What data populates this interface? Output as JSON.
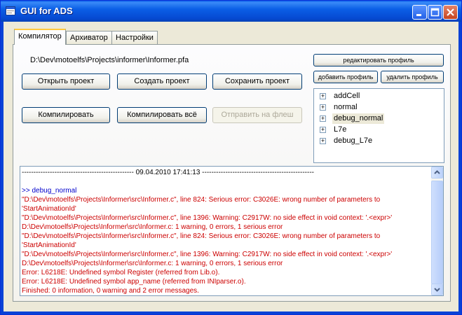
{
  "window": {
    "title": "GUI for ADS"
  },
  "tabs": [
    {
      "label": "Компилятор"
    },
    {
      "label": "Архиватор"
    },
    {
      "label": "Настройки"
    }
  ],
  "compiler": {
    "project_path": "D:\\Dev\\motoelfs\\Projects\\informer\\Informer.pfa",
    "buttons": {
      "open": "Открыть проект",
      "create": "Создать проект",
      "save": "Сохранить проект",
      "compile": "Компилировать",
      "compile_all": "Компилировать всё",
      "send_flash": "Отправить на флеш"
    },
    "profile_buttons": {
      "edit": "редактировать профиль",
      "add": "добавить профиль",
      "delete": "удалить профиль"
    },
    "profiles": [
      {
        "label": "addCell",
        "selected": false
      },
      {
        "label": "normal",
        "selected": false
      },
      {
        "label": "debug_normal",
        "selected": true
      },
      {
        "label": "L7e",
        "selected": false
      },
      {
        "label": "debug_L7e",
        "selected": false
      }
    ],
    "expander_glyph": "+"
  },
  "log": {
    "lines": [
      {
        "kind": "header",
        "text": "------------------------------------------------ 09.04.2010 17:41:13 ------------------------------------------------"
      },
      {
        "kind": "blank",
        "text": ""
      },
      {
        "kind": "blue",
        "text": ">> debug_normal"
      },
      {
        "kind": "red",
        "text": "\"D:\\Dev\\motoelfs\\Projects\\Informer\\src\\Informer.c\", line 824: Serious error: C3026E: wrong number of parameters to"
      },
      {
        "kind": "red",
        "text": "'StartAnimationId'"
      },
      {
        "kind": "red",
        "text": "\"D:\\Dev\\motoelfs\\Projects\\Informer\\src\\Informer.c\", line 1396: Warning: C2917W: no side effect in void context: '.<expr>'"
      },
      {
        "kind": "red",
        "text": "D:\\Dev\\motoelfs\\Projects\\Informer\\src\\Informer.c: 1 warning, 0 errors, 1 serious error"
      },
      {
        "kind": "red",
        "text": "\"D:\\Dev\\motoelfs\\Projects\\Informer\\src\\Informer.c\", line 824: Serious error: C3026E: wrong number of parameters to"
      },
      {
        "kind": "red",
        "text": "'StartAnimationId'"
      },
      {
        "kind": "red",
        "text": "\"D:\\Dev\\motoelfs\\Projects\\Informer\\src\\Informer.c\", line 1396: Warning: C2917W: no side effect in void context: '.<expr>'"
      },
      {
        "kind": "red",
        "text": "D:\\Dev\\motoelfs\\Projects\\Informer\\src\\Informer.c: 1 warning, 0 errors, 1 serious error"
      },
      {
        "kind": "red",
        "text": "Error: L6218E: Undefined symbol Register (referred from Lib.o)."
      },
      {
        "kind": "red",
        "text": "Error: L6218E: Undefined symbol app_name (referred from INIparser.o)."
      },
      {
        "kind": "red",
        "text": "Finished: 0 information, 0 warning and 2 error messages."
      }
    ],
    "scroll_up_glyph": "▲",
    "scroll_down_glyph": "▼"
  },
  "colors": {
    "titlebar": "#0a5ce8",
    "log_error": "#cc0000",
    "log_profile": "#0000cc",
    "active_tab_accent": "#ffc83c"
  }
}
